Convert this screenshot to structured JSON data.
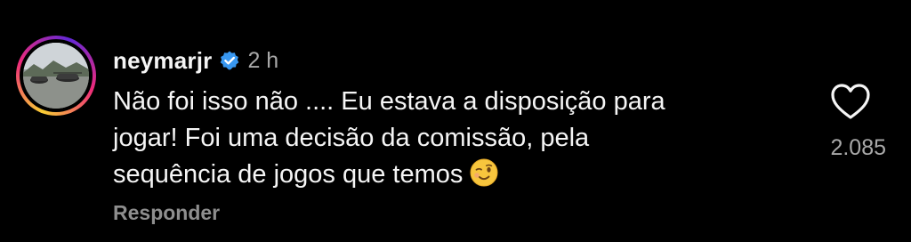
{
  "comment": {
    "username": "neymarjr",
    "verified": true,
    "time": "2 h",
    "text_lines": [
      "Não foi isso não .... Eu estava a disposição para",
      "jogar! Foi uma decisão da comissão, pela",
      "sequência de jogos que temos"
    ],
    "emoji": "winking-face",
    "reply_label": "Responder",
    "likes": "2.085"
  },
  "colors": {
    "background": "#000000",
    "text": "#f5f5f5",
    "muted": "#a8a8a8",
    "verified_blue": "#3897f0"
  },
  "icons": {
    "verified": "verified-badge-icon",
    "like": "heart-outline-icon"
  }
}
